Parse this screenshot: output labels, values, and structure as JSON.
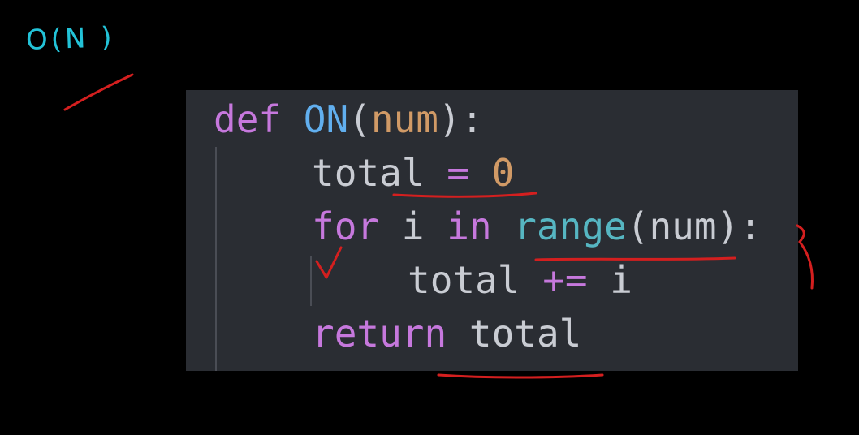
{
  "annotation": {
    "complexity_note": "O(N )"
  },
  "code": {
    "line1": {
      "kw": "def",
      "fn": "ON",
      "open": "(",
      "param": "num",
      "close": "):"
    },
    "line2": {
      "var": "total",
      "op": "=",
      "num": "0"
    },
    "line3": {
      "kw_for": "for",
      "var": "i",
      "kw_in": "in",
      "builtin": "range",
      "open": "(",
      "arg": "num",
      "close": "):"
    },
    "line4": {
      "var": "total",
      "op": "+=",
      "rhs": "i"
    },
    "line5": {
      "kw": "return",
      "var": "total"
    }
  },
  "colors": {
    "background": "#000000",
    "editor_bg": "#2a2d33",
    "keyword": "#c678dd",
    "function": "#61afef",
    "number": "#d19a66",
    "builtin": "#56b6c2",
    "text": "#c9ccd3",
    "ink_red": "#d41f1f",
    "ink_cyan": "#23c3d8"
  }
}
